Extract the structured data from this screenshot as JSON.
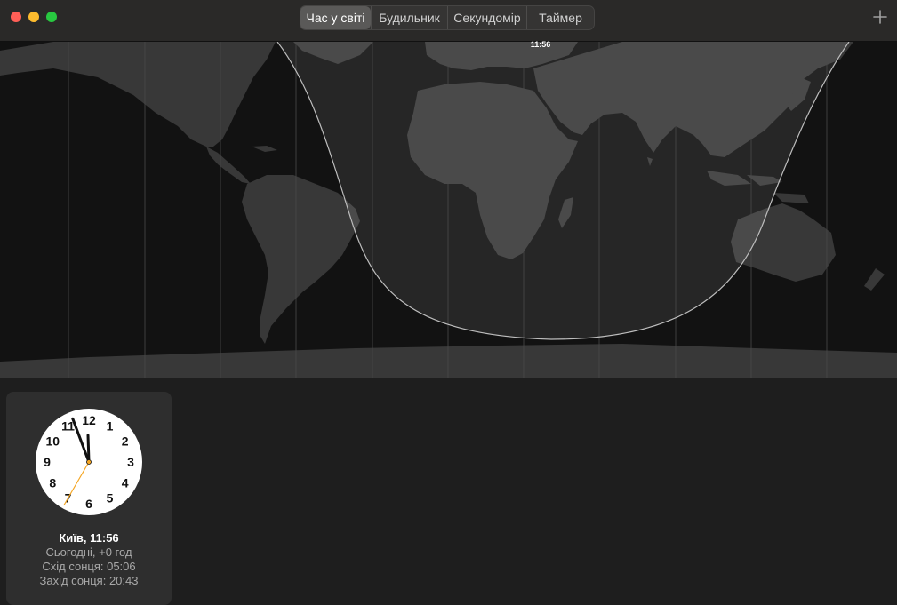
{
  "window": {
    "traffic_lights": {
      "close": "#ff5f57",
      "minimize": "#febc2e",
      "zoom": "#28c840"
    }
  },
  "toolbar": {
    "tabs": [
      {
        "label": "Час у світі",
        "active": true
      },
      {
        "label": "Будильник",
        "active": false
      },
      {
        "label": "Секундомір",
        "active": false
      },
      {
        "label": "Таймер",
        "active": false
      }
    ],
    "add_icon": "plus-icon"
  },
  "map": {
    "current_time": "11:56",
    "colors": {
      "ocean_night": "#121212",
      "ocean_day": "#262626",
      "land_day": "#4a4a4a",
      "land_night": "#383838"
    }
  },
  "cities": [
    {
      "name": "Київ, 11:56",
      "offset": "Сьогодні, +0 год",
      "sunrise": "Схід сонця: 05:06",
      "sunset": "Захід сонця: 20:43",
      "clock": {
        "numerals": [
          "12",
          "1",
          "2",
          "3",
          "4",
          "5",
          "6",
          "7",
          "8",
          "9",
          "10",
          "11"
        ],
        "hour": 11,
        "minute": 56,
        "second": 35,
        "second_hand_color": "#f5a623"
      }
    }
  ]
}
